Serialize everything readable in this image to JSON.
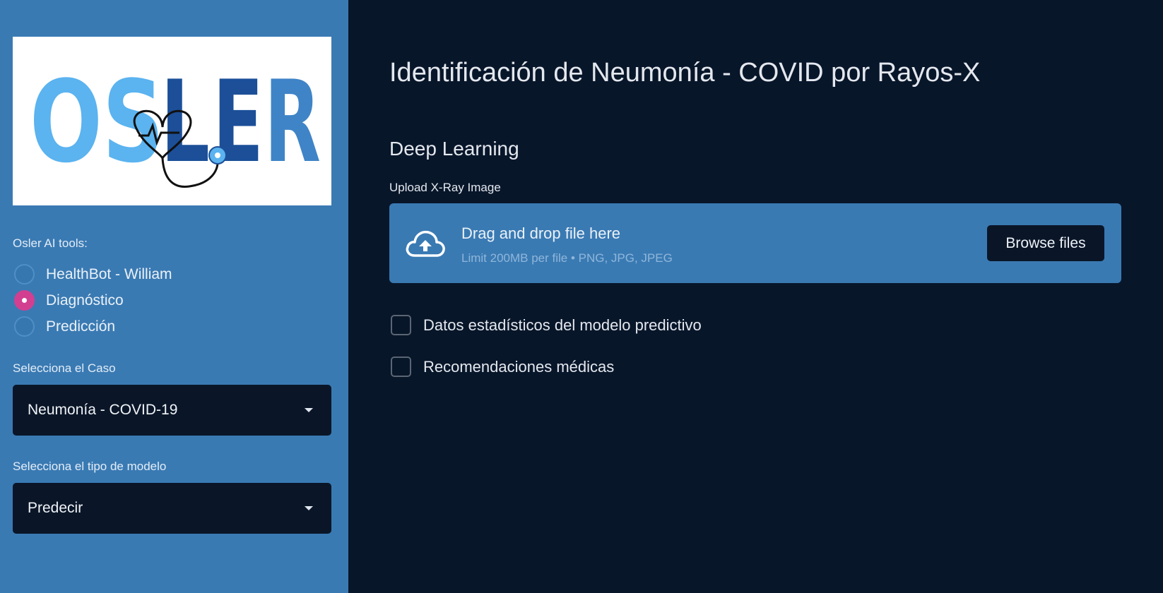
{
  "sidebar": {
    "logo_text": "OSLER",
    "tools_label": "Osler AI tools:",
    "tools": [
      {
        "label": "HealthBot - William",
        "selected": false
      },
      {
        "label": "Diagnóstico",
        "selected": true
      },
      {
        "label": "Predicción",
        "selected": false
      }
    ],
    "case_label": "Selecciona el Caso",
    "case_value": "Neumonía - COVID-19",
    "model_label": "Selecciona el tipo de modelo",
    "model_value": "Predecir"
  },
  "main": {
    "title": "Identificación de Neumonía - COVID por Rayos-X",
    "subtitle": "Deep Learning",
    "upload_label": "Upload X-Ray Image",
    "dropzone": {
      "title": "Drag and drop file here",
      "limit": "Limit 200MB per file • PNG, JPG, JPEG",
      "browse_label": "Browse files",
      "icon": "cloud-upload-icon"
    },
    "checkboxes": [
      {
        "label": "Datos estadísticos del modelo predictivo",
        "checked": false
      },
      {
        "label": "Recomendaciones médicas",
        "checked": false
      }
    ]
  },
  "colors": {
    "sidebar_bg": "#3a7ab3",
    "main_bg": "#08162a",
    "radio_active": "#d23f91",
    "logo_light_blue": "#5bb3ef",
    "logo_dark_blue": "#1c4f98"
  }
}
